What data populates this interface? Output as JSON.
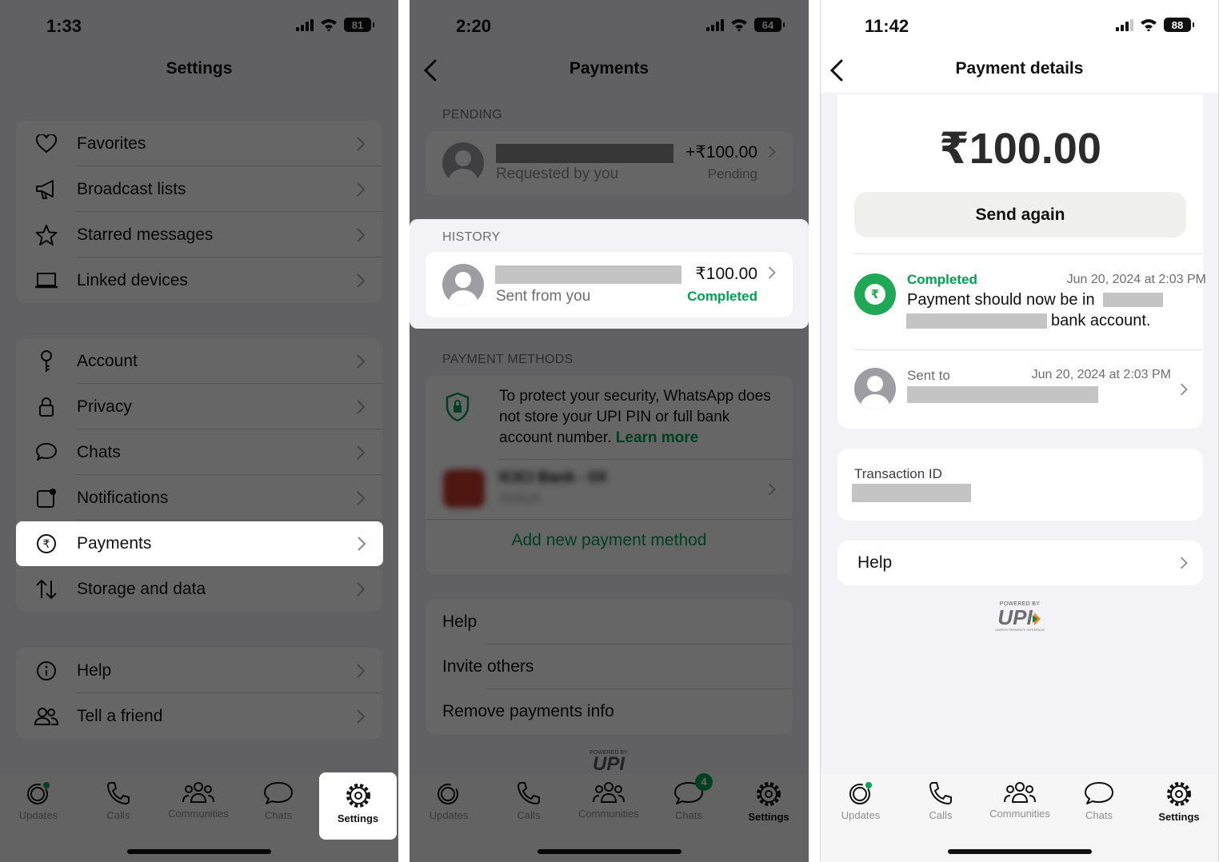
{
  "colors": {
    "accent_green": "#00a152",
    "brand_upi_green": "#0b8a3a",
    "brand_upi_orange": "#f47d20",
    "dim_overlay": "rgba(0,0,0,0.6)"
  },
  "panel1": {
    "status": {
      "time": "1:33",
      "battery": "81"
    },
    "title": "Settings",
    "group1": [
      {
        "label": "Favorites",
        "icon": "heart-icon"
      },
      {
        "label": "Broadcast lists",
        "icon": "megaphone-icon"
      },
      {
        "label": "Starred messages",
        "icon": "star-icon"
      },
      {
        "label": "Linked devices",
        "icon": "laptop-icon"
      }
    ],
    "group2": [
      {
        "label": "Account",
        "icon": "key-icon"
      },
      {
        "label": "Privacy",
        "icon": "lock-icon"
      },
      {
        "label": "Chats",
        "icon": "chat-bubble-icon"
      },
      {
        "label": "Notifications",
        "icon": "notification-icon"
      },
      {
        "label": "Payments",
        "icon": "rupee-circle-icon",
        "highlighted": true
      },
      {
        "label": "Storage and data",
        "icon": "arrows-updown-icon"
      }
    ],
    "group3": [
      {
        "label": "Help",
        "icon": "info-icon"
      },
      {
        "label": "Tell a friend",
        "icon": "people-icon"
      }
    ]
  },
  "panel2": {
    "status": {
      "time": "2:20",
      "battery": "64"
    },
    "title": "Payments",
    "pending": {
      "header": "PENDING",
      "subtitle": "Requested by you",
      "amount": "+₹100.00",
      "status": "Pending"
    },
    "history": {
      "header": "HISTORY",
      "subtitle": "Sent from you",
      "amount": "₹100.00",
      "status": "Completed"
    },
    "methods": {
      "header": "PAYMENT METHODS",
      "security_text": "To protect your security, WhatsApp does not store your UPI PIN or full bank account number.",
      "learn_more": "Learn more",
      "bank_name": "ICICI Bank - 0X",
      "bank_sub": "Default",
      "add_method": "Add new payment method"
    },
    "links": [
      "Help",
      "Invite others",
      "Remove payments info"
    ],
    "chats_badge": "4"
  },
  "panel3": {
    "status": {
      "time": "11:42",
      "battery": "88"
    },
    "title": "Payment details",
    "amount": "₹100.00",
    "send_again": "Send again",
    "completed": {
      "status": "Completed",
      "date": "Jun 20, 2024 at 2:03 PM",
      "line1": "Payment should now be in",
      "line2": "bank account."
    },
    "sent_to": {
      "label": "Sent to",
      "date": "Jun 20, 2024 at 2:03 PM"
    },
    "transaction_label": "Transaction ID",
    "help": "Help"
  },
  "upi_logo": {
    "top": "POWERED BY",
    "word": "UPI",
    "bottom": "UNIFIED PAYMENTS INTERFACE"
  },
  "tabbar": {
    "items": [
      "Updates",
      "Calls",
      "Communities",
      "Chats",
      "Settings"
    ],
    "active": "Settings"
  }
}
